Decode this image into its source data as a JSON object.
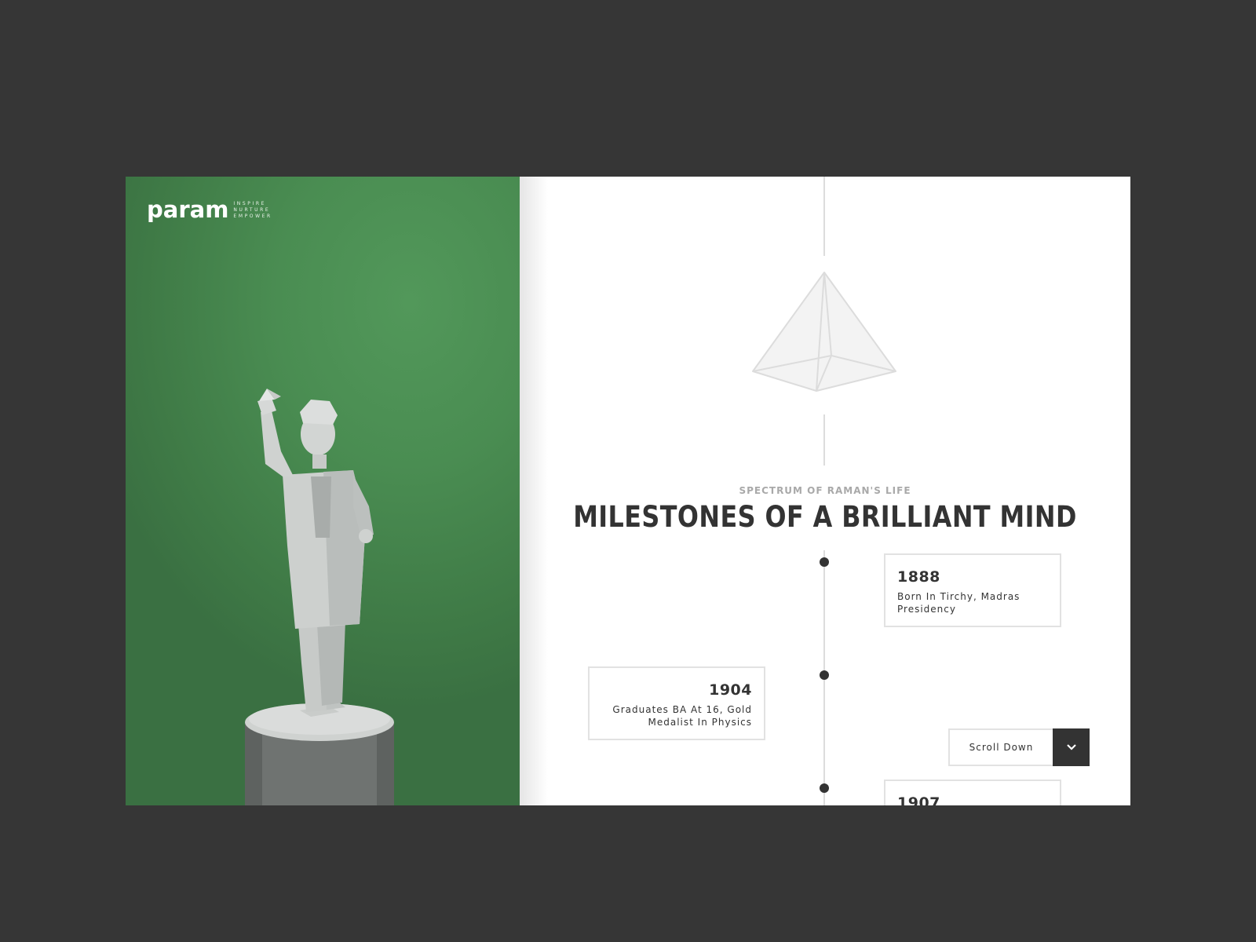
{
  "brand": {
    "name": "param",
    "tagline": [
      "INSPIRE",
      "NURTURE",
      "EMPOWER"
    ]
  },
  "section": {
    "eyebrow": "SPECTRUM OF RAMAN'S LIFE",
    "title": "MILESTONES OF A BRILLIANT MIND"
  },
  "timeline": [
    {
      "year": "1888",
      "description": "Born In Tirchy, Madras Presidency",
      "side": "right"
    },
    {
      "year": "1904",
      "description": "Graduates BA At 16, Gold Medalist In Physics",
      "side": "left"
    },
    {
      "year": "1907",
      "description": "",
      "side": "right"
    }
  ],
  "scroll": {
    "label": "Scroll Down",
    "icon": "chevron-down-icon"
  },
  "colors": {
    "page_background": "#363636",
    "hero_green": "#4a8d52",
    "text_dark": "#333333",
    "eyebrow_gray": "#a9a9a9",
    "border_gray": "#e2e2e2"
  }
}
